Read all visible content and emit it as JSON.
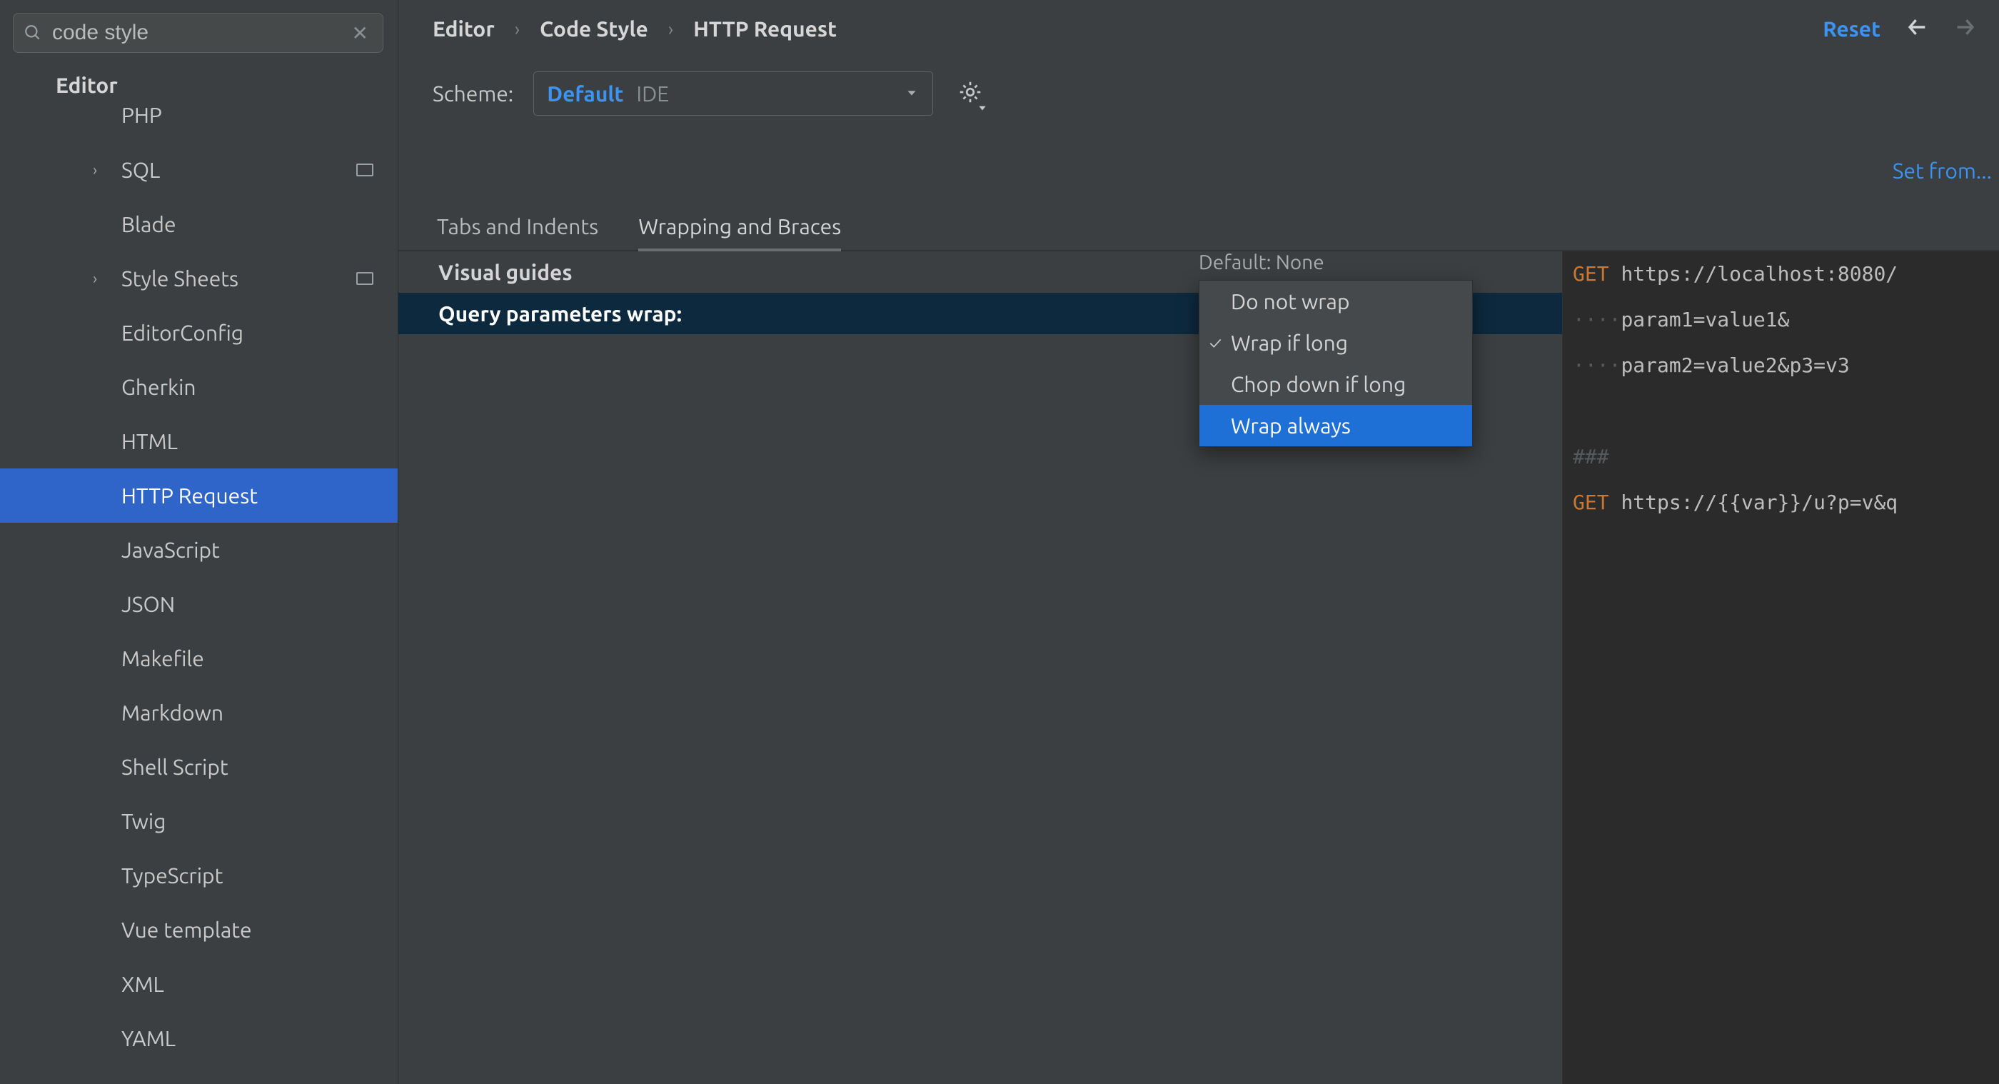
{
  "search": {
    "value": "code style"
  },
  "sidebar": {
    "header": "Editor",
    "items": [
      {
        "label": "PHP",
        "chev": false,
        "pin": false,
        "cutTop": true
      },
      {
        "label": "SQL",
        "chev": true,
        "pin": true
      },
      {
        "label": "Blade",
        "chev": false,
        "pin": false
      },
      {
        "label": "Style Sheets",
        "chev": true,
        "pin": true
      },
      {
        "label": "EditorConfig",
        "chev": false,
        "pin": false
      },
      {
        "label": "Gherkin",
        "chev": false,
        "pin": false
      },
      {
        "label": "HTML",
        "chev": false,
        "pin": false
      },
      {
        "label": "HTTP Request",
        "chev": false,
        "pin": false,
        "selected": true
      },
      {
        "label": "JavaScript",
        "chev": false,
        "pin": false
      },
      {
        "label": "JSON",
        "chev": false,
        "pin": false
      },
      {
        "label": "Makefile",
        "chev": false,
        "pin": false
      },
      {
        "label": "Markdown",
        "chev": false,
        "pin": false
      },
      {
        "label": "Shell Script",
        "chev": false,
        "pin": false
      },
      {
        "label": "Twig",
        "chev": false,
        "pin": false
      },
      {
        "label": "TypeScript",
        "chev": false,
        "pin": false
      },
      {
        "label": "Vue template",
        "chev": false,
        "pin": false
      },
      {
        "label": "XML",
        "chev": false,
        "pin": false
      },
      {
        "label": "YAML",
        "chev": false,
        "pin": false
      }
    ]
  },
  "breadcrumb": [
    "Editor",
    "Code Style",
    "HTTP Request"
  ],
  "topActions": {
    "reset": "Reset"
  },
  "scheme": {
    "label": "Scheme:",
    "name": "Default",
    "scope": "IDE"
  },
  "setFrom": "Set from...",
  "tabs": [
    {
      "label": "Tabs and Indents",
      "active": false
    },
    {
      "label": "Wrapping and Braces",
      "active": true
    }
  ],
  "settings": {
    "visualGuides": {
      "label": "Visual guides",
      "defaultText": "Default: None"
    },
    "queryWrap": {
      "label": "Query parameters wrap:",
      "options": [
        "Do not wrap",
        "Wrap if long",
        "Chop down if long",
        "Wrap always"
      ],
      "checkedIndex": 1,
      "highlightIndex": 3
    }
  },
  "preview": {
    "lines": [
      {
        "segments": [
          {
            "t": "GET ",
            "c": "kw"
          },
          {
            "t": "https://localhost:8080/",
            "c": "text"
          }
        ]
      },
      {
        "segments": [
          {
            "t": "····",
            "c": "dim"
          },
          {
            "t": "param1=value1&",
            "c": "text"
          }
        ]
      },
      {
        "segments": [
          {
            "t": "····",
            "c": "dim"
          },
          {
            "t": "param2=value2&p3=v3",
            "c": "text"
          }
        ]
      },
      {
        "segments": [
          {
            "t": " ",
            "c": "text"
          }
        ]
      },
      {
        "segments": [
          {
            "t": "###",
            "c": "dim"
          }
        ]
      },
      {
        "segments": [
          {
            "t": "GET ",
            "c": "kw"
          },
          {
            "t": "https://{{var}}/u?p=v&q",
            "c": "text"
          }
        ]
      }
    ]
  }
}
